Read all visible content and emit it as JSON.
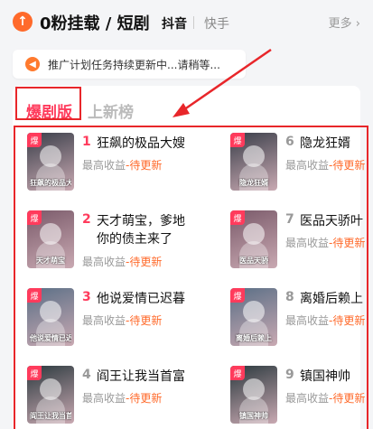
{
  "header": {
    "logo_glyph": "↑",
    "title": "0粉挂载 / 短剧",
    "tabs": [
      {
        "label": "抖音",
        "active": true
      },
      {
        "label": "快手",
        "active": false
      }
    ],
    "more_label": "更多 ›"
  },
  "notice": {
    "icon": "speaker-icon",
    "text": "推广计划任务持续更新中...请稍等..."
  },
  "ranking_tabs": [
    {
      "label": "爆剧版",
      "active": true
    },
    {
      "label": "上新榜",
      "active": false
    }
  ],
  "dramas": {
    "badge": "爆",
    "earn_label": "最高收益",
    "earn_status": "-待更新",
    "left": [
      {
        "rank": "1",
        "title": "狂飙的极品大嫂",
        "cover_caption": "狂飙的极品大嫂"
      },
      {
        "rank": "2",
        "title": "天才萌宝，爹地你的债主来了",
        "cover_caption": "天才萌宝"
      },
      {
        "rank": "3",
        "title": "他说爱情已迟暮",
        "cover_caption": "他说爱情已迟暮"
      },
      {
        "rank": "4",
        "title": "阎王让我当首富",
        "cover_caption": "阎王让我当首富"
      }
    ],
    "right": [
      {
        "rank": "6",
        "title": "隐龙狂婿",
        "cover_caption": "隐龙狂婿"
      },
      {
        "rank": "7",
        "title": "医品天骄叶",
        "cover_caption": "医品天骄"
      },
      {
        "rank": "8",
        "title": "离婚后赖上",
        "cover_caption": "离婚后赖上"
      },
      {
        "rank": "9",
        "title": "镇国神帅",
        "cover_caption": "镇国神帅"
      }
    ]
  },
  "colors": {
    "accent": "#ff6a2b",
    "rank_red": "#ff3b5c",
    "rank_gray": "#999999",
    "annotation": "#e8262a"
  }
}
